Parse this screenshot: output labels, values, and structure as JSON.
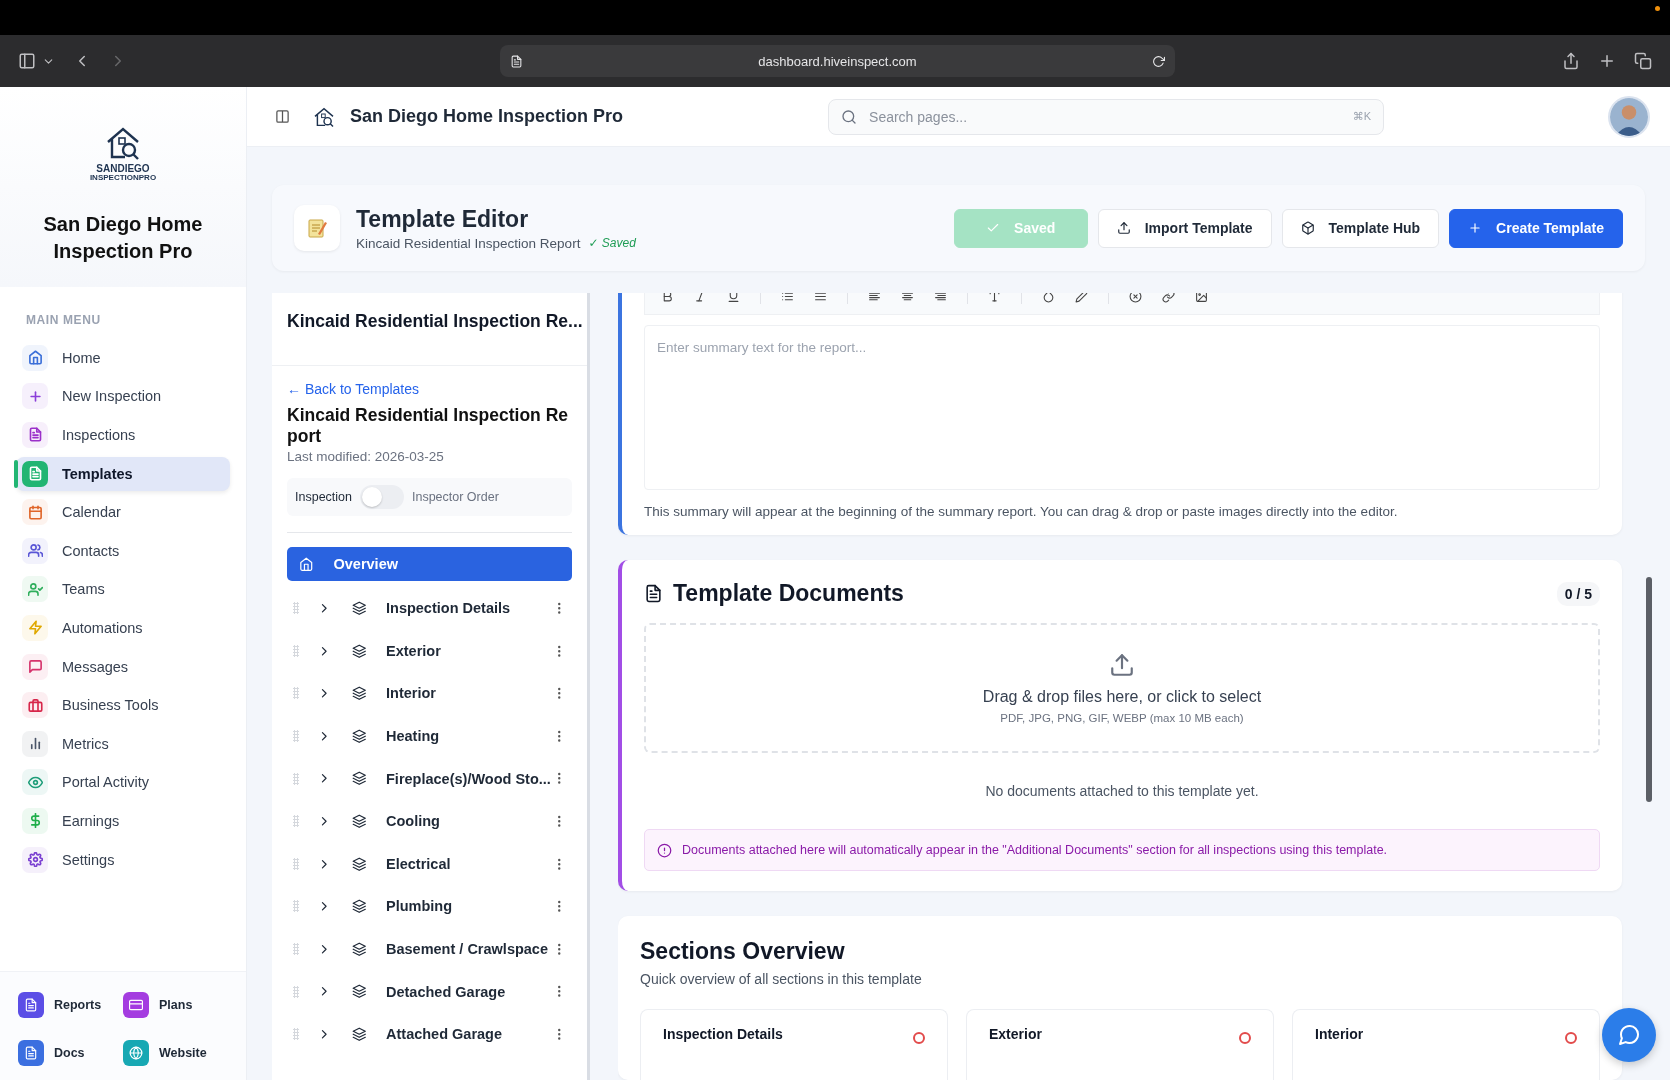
{
  "browser": {
    "url": "dashboard.hiveinspect.com"
  },
  "sidebar": {
    "logo_text": [
      "SANDIEGO",
      "INSPECTIONPRO"
    ],
    "brand": "San Diego Home Inspection Pro",
    "menu_label": "MAIN MENU",
    "items": [
      {
        "label": "Home",
        "selected": false,
        "color": "#3b6fd8"
      },
      {
        "label": "New Inspection",
        "selected": false,
        "color": "#8b3fd9"
      },
      {
        "label": "Inspections",
        "selected": false,
        "color": "#9b30c9"
      },
      {
        "label": "Templates",
        "selected": true,
        "color": "#22b573"
      },
      {
        "label": "Calendar",
        "selected": false,
        "color": "#e0662a"
      },
      {
        "label": "Contacts",
        "selected": false,
        "color": "#5a56d6"
      },
      {
        "label": "Teams",
        "selected": false,
        "color": "#2fae5c"
      },
      {
        "label": "Automations",
        "selected": false,
        "color": "#e0a800"
      },
      {
        "label": "Messages",
        "selected": false,
        "color": "#d6336c"
      },
      {
        "label": "Business Tools",
        "selected": false,
        "color": "#d7264a"
      },
      {
        "label": "Metrics",
        "selected": false,
        "color": "#4a5568"
      },
      {
        "label": "Portal Activity",
        "selected": false,
        "color": "#1f9e7a"
      },
      {
        "label": "Earnings",
        "selected": false,
        "color": "#1fae4a"
      },
      {
        "label": "Settings",
        "selected": false,
        "color": "#7a3fd1"
      }
    ],
    "quick_links": [
      {
        "label": "Reports",
        "color": "#5b4ee6"
      },
      {
        "label": "Plans",
        "color": "#a43ce0"
      },
      {
        "label": "Docs",
        "color": "#3b6fe0"
      },
      {
        "label": "Website",
        "color": "#17a8b3"
      }
    ]
  },
  "header": {
    "title": "San Diego Home Inspection Pro",
    "search": {
      "placeholder": "Search pages...",
      "shortcut": "⌘K"
    }
  },
  "editor_header": {
    "title": "Template Editor",
    "subtitle": "Kincaid Residential Inspection Report",
    "status": "✓ Saved",
    "buttons": [
      {
        "label": "Saved",
        "kind": "saved",
        "disabled": true
      },
      {
        "label": "Import Template",
        "kind": "import",
        "disabled": false
      },
      {
        "label": "Template Hub",
        "kind": "hub",
        "disabled": false
      },
      {
        "label": "Create Template",
        "kind": "create",
        "disabled": false
      }
    ]
  },
  "outline": {
    "heading": "Kincaid Residential Inspection Re...",
    "back_link": "← Back to Templates",
    "title": "Kincaid Residential Inspection Report",
    "modified": "Last modified: 2026-03-25",
    "toggle": {
      "left": "Inspection",
      "right": "Inspector Order",
      "on": false
    },
    "overview": {
      "label": "Overview",
      "selected": true
    },
    "sections": [
      {
        "label": "Inspection Details"
      },
      {
        "label": "Exterior"
      },
      {
        "label": "Interior"
      },
      {
        "label": "Heating"
      },
      {
        "label": "Fireplace(s)/Wood Sto..."
      },
      {
        "label": "Cooling"
      },
      {
        "label": "Electrical"
      },
      {
        "label": "Plumbing"
      },
      {
        "label": "Basement / Crawlspace"
      },
      {
        "label": "Detached Garage"
      },
      {
        "label": "Attached Garage"
      }
    ]
  },
  "summary": {
    "placeholder": "Enter summary text for the report...",
    "help": "This summary will appear at the beginning of the summary report. You can drag & drop or paste images directly into the editor."
  },
  "documents": {
    "title": "Template Documents",
    "count": "0 / 5",
    "drop_title": "Drag & drop files here, or click to select",
    "drop_hint": "PDF, JPG, PNG, GIF, WEBP (max 10 MB each)",
    "empty": "No documents attached to this template yet.",
    "notice": "Documents attached here will automatically appear in the \"Additional Documents\" section for all inspections using this template."
  },
  "sections_overview": {
    "title": "Sections Overview",
    "subtitle": "Quick overview of all sections in this template",
    "cards": [
      {
        "title": "Inspection Details"
      },
      {
        "title": "Exterior"
      },
      {
        "title": "Interior"
      }
    ]
  }
}
